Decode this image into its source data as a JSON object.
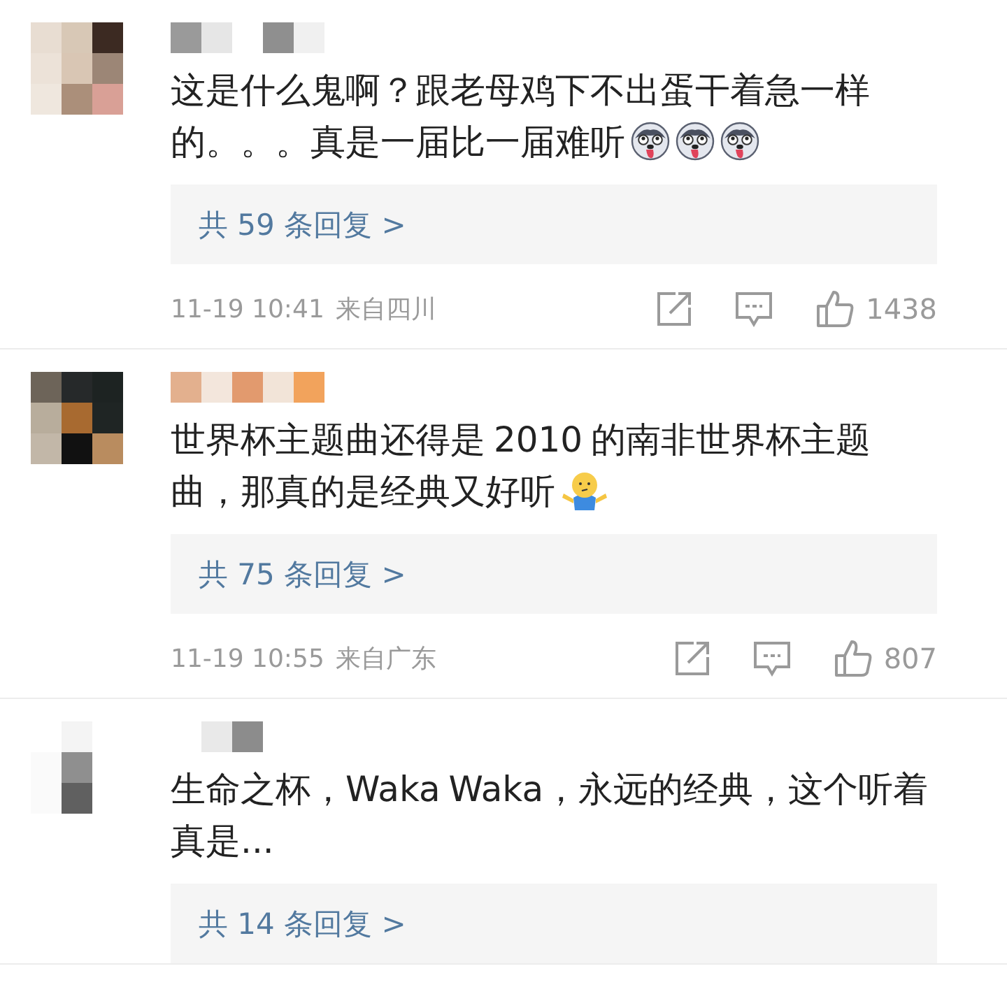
{
  "comments": [
    {
      "text": "这是什么鬼啊？跟老母鸡下不出蛋干着急一样的。。。真是一届比一届难听",
      "emojis": [
        {
          "kind": "husky"
        },
        {
          "kind": "husky"
        },
        {
          "kind": "husky"
        }
      ],
      "replies": "共 59 条回复 >",
      "meta": {
        "time": "11-19 10:41",
        "location": "来自四川",
        "likes": "1438"
      }
    },
    {
      "text": "世界杯主题曲还得是 2010 的南非世界杯主题曲，那真的是经典又好听",
      "emojis": [
        {
          "kind": "shrug"
        }
      ],
      "replies": "共 75 条回复 >",
      "meta": {
        "time": "11-19 10:55",
        "location": "来自广东",
        "likes": "807"
      }
    },
    {
      "text": "生命之杯，Waka Waka，永远的经典，这个听着真是...",
      "replies": "共 14 条回复 >"
    }
  ]
}
